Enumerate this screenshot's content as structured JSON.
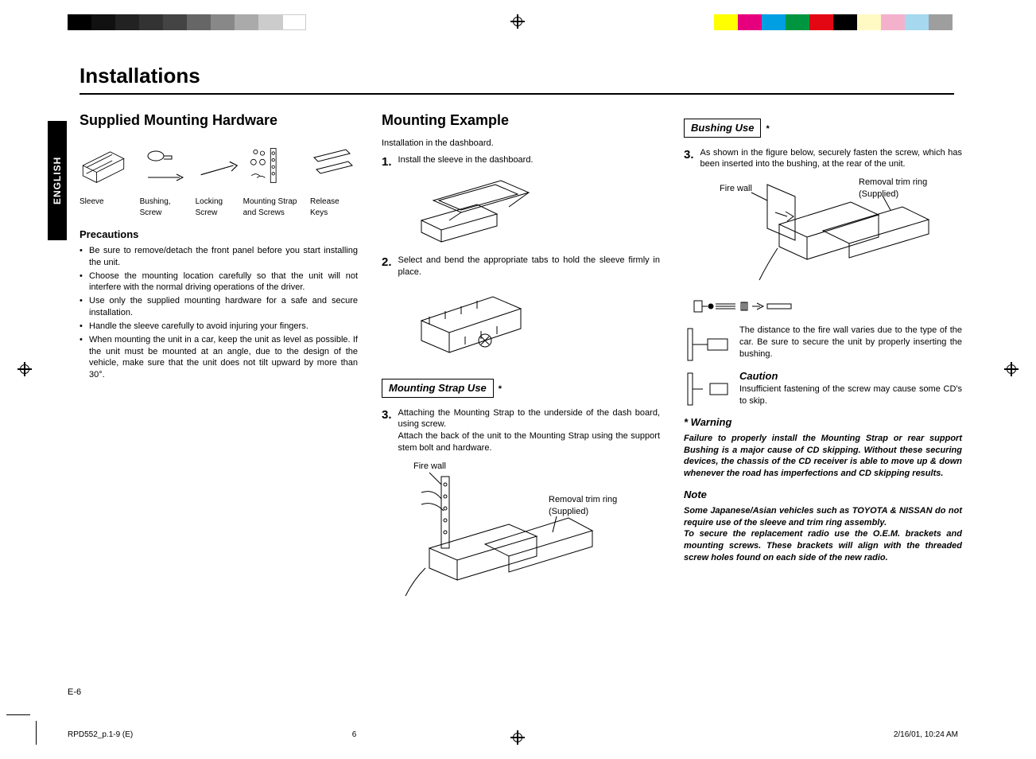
{
  "page": {
    "title": "Installations",
    "language_tab": "ENGLISH",
    "page_number_display": "E-6",
    "footer_left": "RPD552_p.1-9 (E)",
    "footer_center": "6",
    "footer_right": "2/16/01, 10:24 AM"
  },
  "print_marks": {
    "left_grays": [
      "#000000",
      "#111111",
      "#222222",
      "#333333",
      "#444444",
      "#666666",
      "#888888",
      "#aaaaaa",
      "#cccccc",
      "#ffffff"
    ],
    "right_colors": [
      "#ffff00",
      "#e6007e",
      "#009ee3",
      "#009640",
      "#e30613",
      "#000000",
      "#fff9c4",
      "#f4b1cc",
      "#a6d8f0",
      "#9e9e9e"
    ]
  },
  "col1": {
    "supplied_heading": "Supplied Mounting Hardware",
    "hardware": [
      {
        "label": "Sleeve"
      },
      {
        "label": "Bushing, Screw"
      },
      {
        "label": "Locking Screw"
      },
      {
        "label": "Mounting Strap and Screws"
      },
      {
        "label": "Release Keys"
      }
    ],
    "precautions_heading": "Precautions",
    "precautions": [
      "Be sure to remove/detach the front panel before you start installing the unit.",
      "Choose the mounting location carefully so that the unit will not interfere with the normal driving operations of the driver.",
      "Use only the supplied mounting hardware for a safe and secure installation.",
      "Handle the sleeve carefully to avoid injuring your fingers.",
      "When mounting the unit in a car, keep the unit as level as possible. If the unit must be mounted at an angle, due to the design of the vehicle, make sure that the unit does not tilt upward by more than 30°."
    ]
  },
  "col2": {
    "heading": "Mounting Example",
    "intro": "Installation in the dashboard.",
    "step1": "Install the sleeve in the dashboard.",
    "step2": "Select and bend the appropriate tabs to hold the sleeve firmly in place.",
    "strap_box": "Mounting Strap Use",
    "step3_a": "Attaching the Mounting Strap to the underside of the dash board, using screw.",
    "step3_b": "Attach the back of the unit to the Mounting Strap using the support stem bolt and hardware.",
    "fig_firewall": "Fire wall",
    "fig_trim_a": "Removal trim ring",
    "fig_trim_b": "(Supplied)"
  },
  "col3": {
    "bushing_box": "Bushing Use",
    "step3": "As shown in the figure below, securely fasten the screw, which has been inserted into the bushing, at the rear of the unit.",
    "fig_firewall": "Fire wall",
    "fig_trim_a": "Removal trim ring",
    "fig_trim_b": "(Supplied)",
    "distance_text": "The distance to the fire wall varies due to the type of the car. Be sure to secure the unit by properly inserting the bushing.",
    "caution_head": "Caution",
    "caution_text": "Insufficient fastening of the screw may cause some CD's to skip.",
    "warning_head": "* Warning",
    "warning_text": "Failure to properly install the Mounting Strap or rear support Bushing is a major cause of CD skipping. Without these securing devices, the chassis of the CD receiver is able to move up & down whenever the road has imperfections and CD skipping results.",
    "note_head": "Note",
    "note_text_a": "Some Japanese/Asian vehicles such as TOYOTA & NISSAN do not require use of the sleeve and trim ring assembly.",
    "note_text_b": "To secure the replacement radio use the O.E.M. brackets and mounting screws. These brackets will align with the threaded screw holes found on each side of the new radio."
  }
}
